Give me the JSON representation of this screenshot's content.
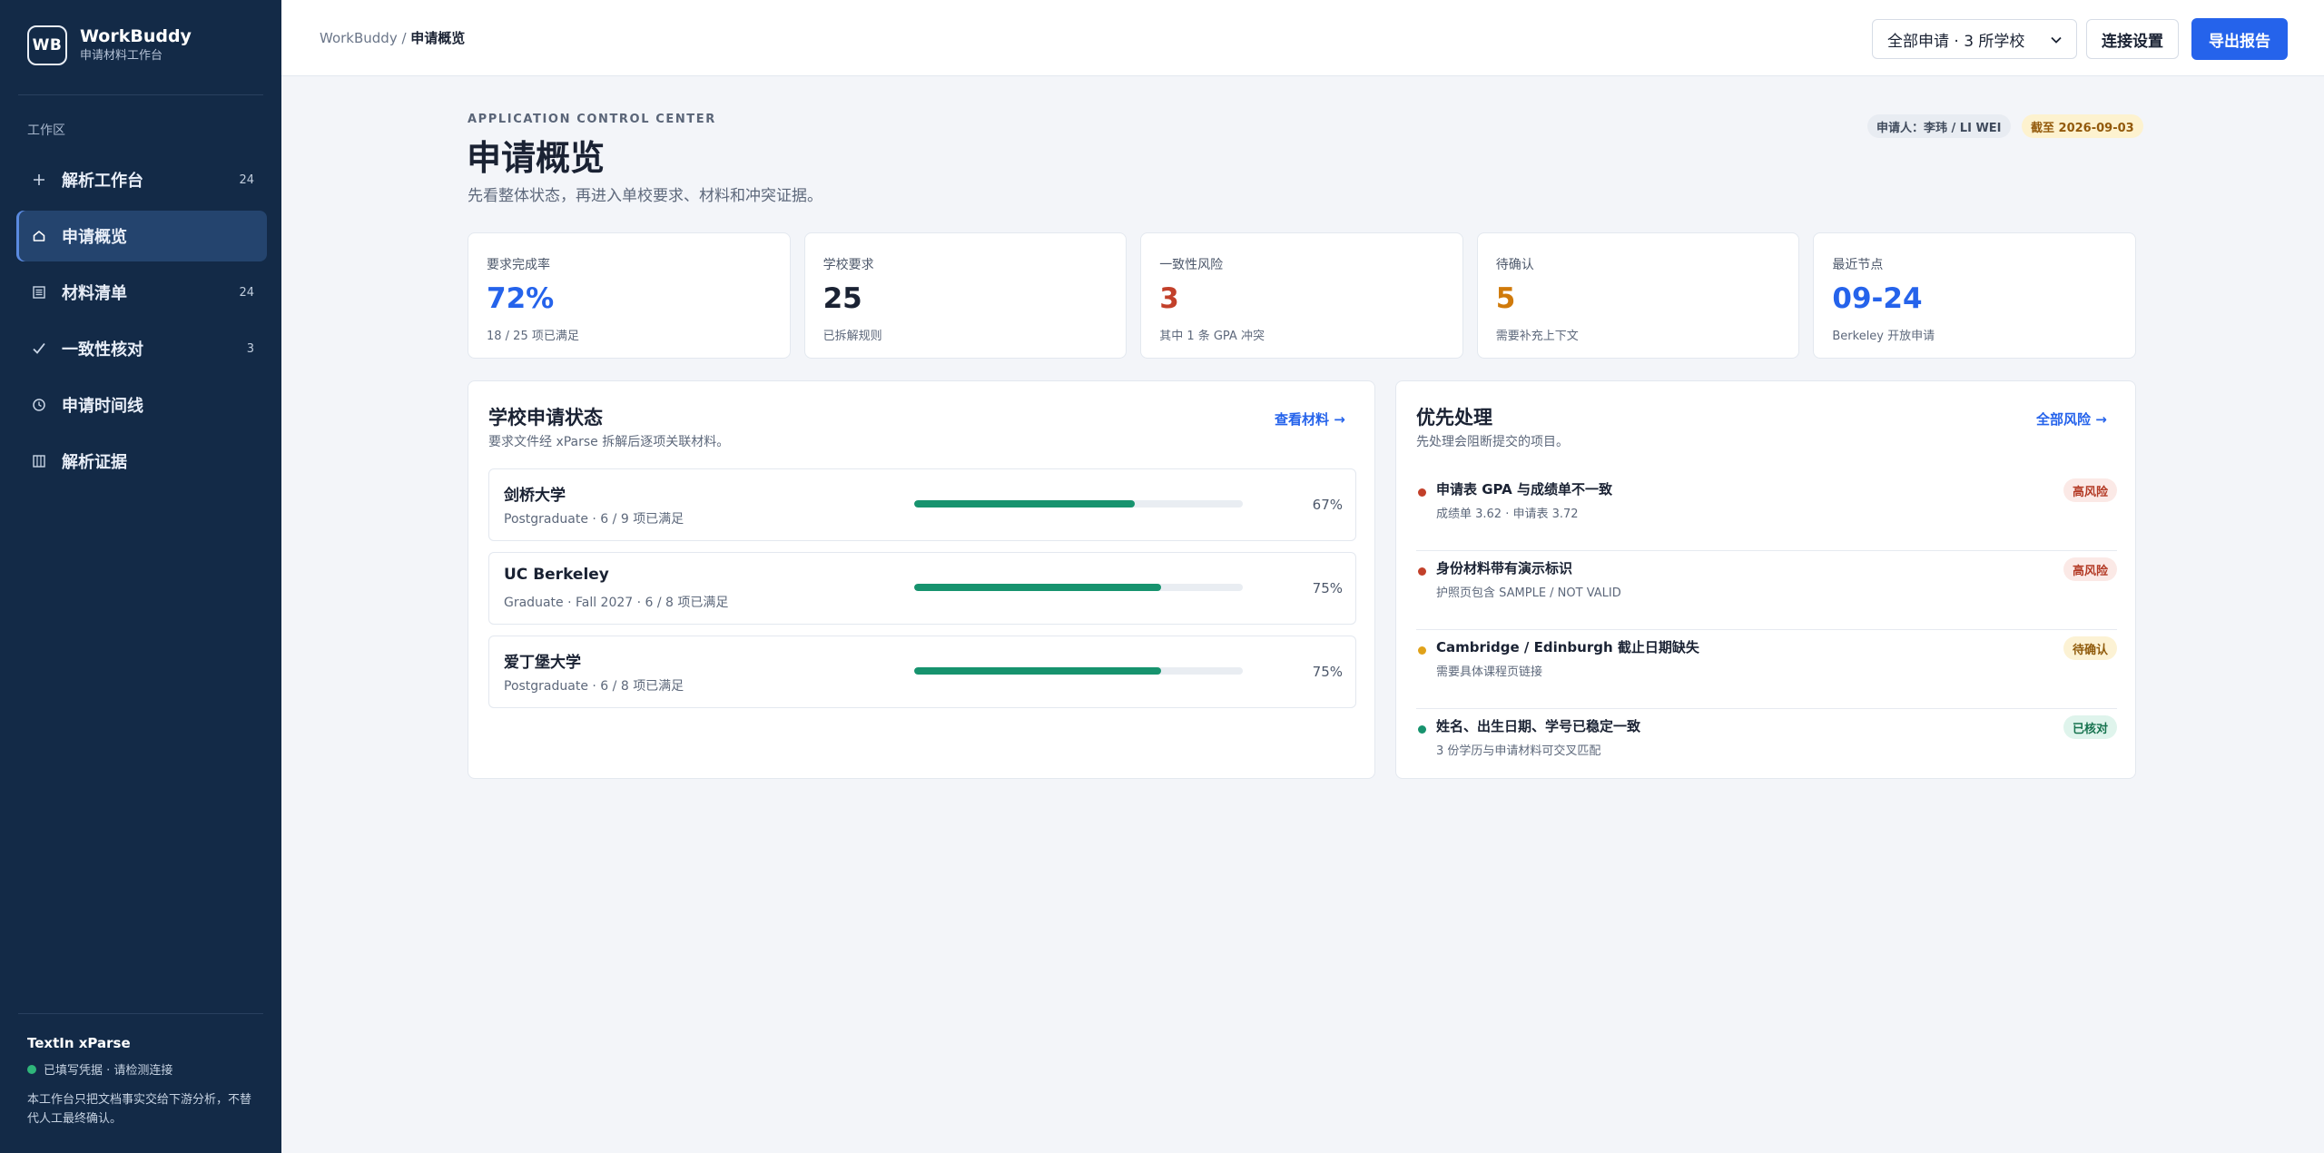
{
  "brand": {
    "logo": "WB",
    "name": "WorkBuddy",
    "subtitle": "申请材料工作台"
  },
  "sidebar": {
    "section": "工作区",
    "items": [
      {
        "icon": "plus-icon",
        "label": "解析工作台",
        "count": "24"
      },
      {
        "icon": "home-icon",
        "label": "申请概览",
        "count": ""
      },
      {
        "icon": "list-icon",
        "label": "材料清单",
        "count": "24"
      },
      {
        "icon": "check-icon",
        "label": "一致性核对",
        "count": "3"
      },
      {
        "icon": "clock-icon",
        "label": "申请时间线",
        "count": ""
      },
      {
        "icon": "columns-icon",
        "label": "解析证据",
        "count": ""
      }
    ],
    "footer": {
      "title": "TextIn xParse",
      "status": "已填写凭据 · 请检测连接",
      "note": "本工作台只把文档事实交给下游分析，不替代人工最终确认。"
    }
  },
  "topbar": {
    "breadcrumb_root": "WorkBuddy",
    "breadcrumb_sep": " / ",
    "breadcrumb_current": "申请概览",
    "scope_select": "全部申请 · 3 所学校",
    "connect_button": "连接设置",
    "export_button": "导出报告"
  },
  "header": {
    "kicker": "APPLICATION CONTROL CENTER",
    "title": "申请概览",
    "subtitle": "先看整体状态，再进入单校要求、材料和冲突证据。",
    "applicant": "申请人：李玮 / LI WEI",
    "deadline": "截至 2026-09-03"
  },
  "stats": [
    {
      "label": "要求完成率",
      "value": "72%",
      "note": "18 / 25 项已满足",
      "color": "#2563eb"
    },
    {
      "label": "学校要求",
      "value": "25",
      "note": "已拆解规则",
      "color": "#1a2233"
    },
    {
      "label": "一致性风险",
      "value": "3",
      "note": "其中 1 条 GPA 冲突",
      "color": "#c2402a"
    },
    {
      "label": "待确认",
      "value": "5",
      "note": "需要补充上下文",
      "color": "#d07a0a"
    },
    {
      "label": "最近节点",
      "value": "09-24",
      "note": "Berkeley 开放申请",
      "color": "#2563eb"
    }
  ],
  "schools_panel": {
    "title": "学校申请状态",
    "subtitle": "要求文件经 xParse 拆解后逐项关联材料。",
    "link": "查看材料 →",
    "rows": [
      {
        "name": "剑桥大学",
        "meta": "Postgraduate · 6 / 9 项已满足",
        "progress": 0.67,
        "percent": "67%"
      },
      {
        "name": "UC Berkeley",
        "meta": "Graduate · Fall 2027 · 6 / 8 项已满足",
        "progress": 0.75,
        "percent": "75%"
      },
      {
        "name": "爱丁堡大学",
        "meta": "Postgraduate · 6 / 8 项已满足",
        "progress": 0.75,
        "percent": "75%"
      }
    ]
  },
  "priority_panel": {
    "title": "优先处理",
    "subtitle": "先处理会阻断提交的项目。",
    "link": "全部风险 →",
    "items": [
      {
        "title": "申请表 GPA 与成绩单不一致",
        "desc": "成绩单 3.62 · 申请表 3.72",
        "badge": "高风险",
        "level": "high",
        "dot": "#c2402a"
      },
      {
        "title": "身份材料带有演示标识",
        "desc": "护照页包含 SAMPLE / NOT VALID",
        "badge": "高风险",
        "level": "high",
        "dot": "#c2402a"
      },
      {
        "title": "Cambridge / Edinburgh 截止日期缺失",
        "desc": "需要具体课程页链接",
        "badge": "待确认",
        "level": "pending",
        "dot": "#e0a21a"
      },
      {
        "title": "姓名、出生日期、学号已稳定一致",
        "desc": "3 份学历与申请材料可交叉匹配",
        "badge": "已核对",
        "level": "ok",
        "dot": "#17936e"
      }
    ]
  }
}
